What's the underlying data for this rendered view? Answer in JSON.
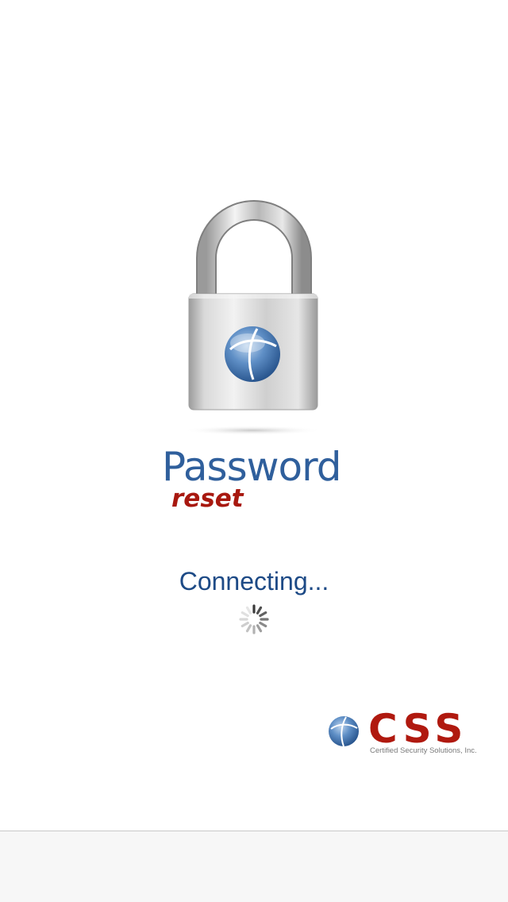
{
  "app": {
    "title_main": "Password",
    "title_sub": "reset"
  },
  "status": {
    "text": "Connecting..."
  },
  "brand": {
    "name": "CSS",
    "tagline": "Certified Security Solutions, Inc."
  },
  "icons": {
    "lock": "padlock-icon",
    "spinner": "activity-spinner-icon",
    "globe": "globe-icon"
  },
  "colors": {
    "title_blue": "#2f5f9c",
    "reset_red": "#a8180f",
    "status_blue": "#1d4a86",
    "brand_red": "#b0190f"
  }
}
